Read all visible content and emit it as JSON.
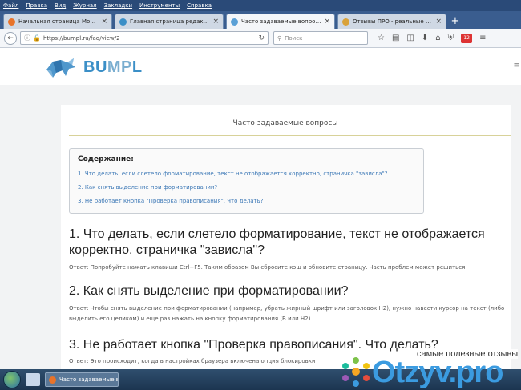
{
  "menubar": [
    "Файл",
    "Правка",
    "Вид",
    "Журнал",
    "Закладки",
    "Инструменты",
    "Справка"
  ],
  "tabs": [
    {
      "title": "Начальная страница Mozilla ...",
      "favicon_color": "#e8732a",
      "active": false
    },
    {
      "title": "Главная страница редактора",
      "favicon_color": "#3b8fc7",
      "active": false
    },
    {
      "title": "Часто задаваемые вопросы",
      "favicon_color": "#5aa0d6",
      "active": true
    },
    {
      "title": "Отзывы ПРО - реальные от...",
      "favicon_color": "#d9a23a",
      "active": false
    }
  ],
  "nav": {
    "url": "https://bumpl.ru/faq/view/2",
    "search_placeholder": "Поиск",
    "badge": "12"
  },
  "header": {
    "logo_part1": "BU",
    "logo_part2": "MP",
    "logo_part3": "L",
    "menu_glyph": "≡"
  },
  "content": {
    "page_title": "Часто задаваемые вопросы",
    "toc_title": "Содержание:",
    "toc_links": [
      "1. Что делать, если слетело форматирование, текст не отображается корректно, страничка \"зависла\"?",
      "2. Как снять выделение при форматировании?",
      "3. Не работает кнопка \"Проверка правописания\". Что делать?"
    ],
    "q1": "1. Что делать, если слетело форматирование, текст не отображается корректно, страничка \"зависла\"?",
    "a1": "Ответ: Попробуйте нажать клавиши Ctrl+F5. Таким образом Вы сбросите кэш и обновите страницу. Часть проблем может решиться.",
    "q2": "2. Как снять выделение при форматировании?",
    "a2": "Ответ: Чтобы снять выделение при форматировании (например, убрать жирный шрифт или заголовок H2), нужно навести курсор на текст (либо выделить его целиком) и еще раз нажать на кнопку форматирования (B или H2).",
    "q3": "3. Не работает кнопка \"Проверка правописания\". Что делать?",
    "a3": "Ответ: Это происходит, когда в настройках браузера включена опция блокировки"
  },
  "watermark": {
    "subtitle": "самые полезные отзывы",
    "text": "Otzyv.pro"
  },
  "taskbar": {
    "task_title": "Часто задаваемые в..."
  },
  "colors": {
    "link": "#3c78b6",
    "brand_blue": "#3b8fc7",
    "title_rule": "#d8d299"
  }
}
